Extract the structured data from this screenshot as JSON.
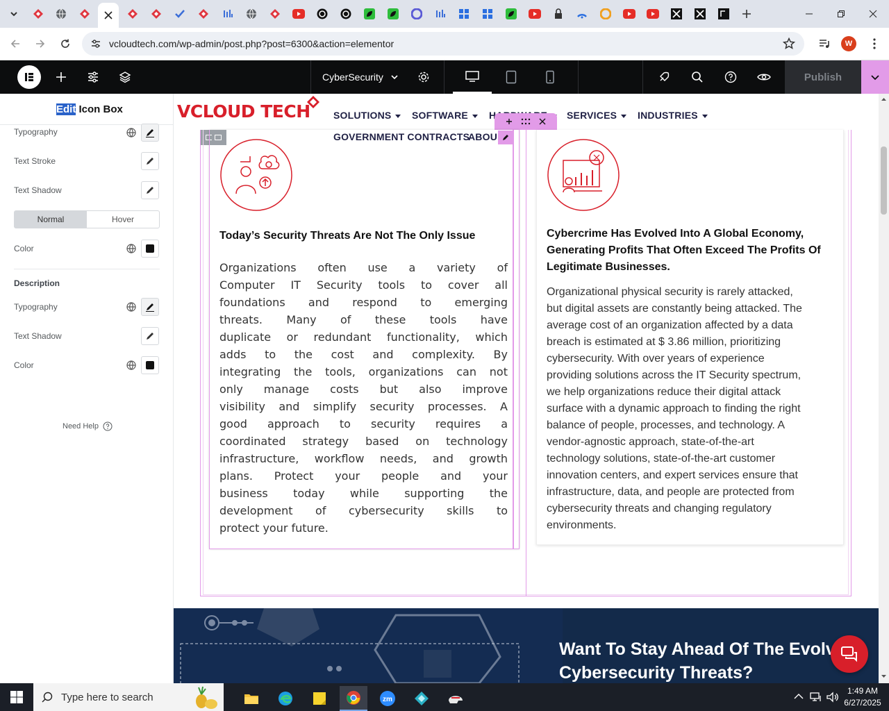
{
  "browser": {
    "url": "vcloudtech.com/wp-admin/post.php?post=6300&action=elementor",
    "tabs": [
      {
        "icon": "gem-icon",
        "color": "#e0363f"
      },
      {
        "icon": "globe-icon",
        "color": "#5f6368"
      },
      {
        "icon": "gem-icon",
        "color": "#e0363f"
      },
      {
        "icon": "close-icon",
        "color": "#222"
      },
      {
        "icon": "gem-icon",
        "color": "#e0363f"
      },
      {
        "icon": "gem-icon",
        "color": "#e0363f"
      },
      {
        "icon": "check-icon",
        "color": "#3b6ed8"
      },
      {
        "icon": "gem-icon",
        "color": "#e0363f"
      },
      {
        "icon": "bars-icon",
        "color": "#3b6ed8"
      },
      {
        "icon": "globe-icon",
        "color": "#5f6368"
      },
      {
        "icon": "gem-icon",
        "color": "#e0363f"
      },
      {
        "icon": "youtube-icon",
        "color": "#e52d27"
      },
      {
        "icon": "openai-icon",
        "color": "#111"
      },
      {
        "icon": "openai-icon",
        "color": "#111"
      },
      {
        "icon": "leaf-icon",
        "color": "#2ebd3c"
      },
      {
        "icon": "leaf-icon",
        "color": "#2ebd3c"
      },
      {
        "icon": "circle-icon",
        "color": "#5b5bd6"
      },
      {
        "icon": "bars-icon",
        "color": "#3b6ed8"
      },
      {
        "icon": "grid-icon",
        "color": "#2b6fe0"
      },
      {
        "icon": "grid-icon",
        "color": "#2b6fe0"
      },
      {
        "icon": "leaf-icon",
        "color": "#2ebd3c"
      },
      {
        "icon": "youtube-icon",
        "color": "#e52d27"
      },
      {
        "icon": "lock-icon",
        "color": "#333"
      },
      {
        "icon": "wifi-icon",
        "color": "#2b6fe0"
      },
      {
        "icon": "circle-icon",
        "color": "#f0a020"
      },
      {
        "icon": "youtube-icon",
        "color": "#e52d27"
      },
      {
        "icon": "youtube-icon",
        "color": "#e52d27"
      },
      {
        "icon": "x-logo-icon",
        "color": "#111"
      },
      {
        "icon": "x-logo-icon",
        "color": "#111"
      },
      {
        "icon": "square-icon",
        "color": "#111"
      }
    ],
    "profile_initial": "W"
  },
  "elementor": {
    "page_name": "CyberSecurity",
    "publish_label": "Publish"
  },
  "panel": {
    "title_highlight": "Edit",
    "title_rest": " Icon Box",
    "typography_label": "Typography",
    "text_stroke_label": "Text Stroke",
    "text_shadow_label": "Text Shadow",
    "normal_tab": "Normal",
    "hover_tab": "Hover",
    "color_label": "Color",
    "description_heading": "Description",
    "desc_typography_label": "Typography",
    "desc_text_shadow_label": "Text Shadow",
    "desc_color_label": "Color",
    "need_help": "Need Help"
  },
  "site": {
    "logo_text": "VCLOUD TECH",
    "menu": [
      "SOLUTIONS",
      "SOFTWARE",
      "HARDWARE",
      "SERVICES",
      "INDUSTRIES"
    ],
    "menu2": [
      "GOVERNMENT CONTRACTS",
      "ABOUT US"
    ],
    "card1": {
      "title": "Today’s Security Threats Are Not The Only Issue",
      "lines": [
        "Organizations often use a variety of",
        "Computer IT Security tools to cover all",
        "foundations and respond to emerging",
        "threats. Many of these tools have",
        "duplicate or redundant functionality, which",
        "adds to the cost and complexity. By",
        "integrating the tools, organizations can not",
        "only manage costs but also improve",
        "visibility and simplify security processes. A",
        "good approach to security requires a",
        "coordinated strategy based on technology",
        "infrastructure, workflow needs, and growth",
        "plans. Protect your people and your",
        "business today while supporting the",
        "development of cybersecurity skills to",
        "protect your future."
      ]
    },
    "card2": {
      "title_lines": [
        "Cybercrime Has Evolved Into A Global Economy,",
        "Generating Profits That Often Exceed The Profits Of",
        "Legitimate Businesses."
      ],
      "lines": [
        "Organizational physical security is rarely attacked,",
        "but digital assets are constantly being attacked. The",
        "average cost of an organization affected by a data",
        "breach is estimated at $ 3.86 million, prioritizing",
        "cybersecurity. With over years of experience",
        "providing solutions across the IT Security spectrum,",
        "we help organizations reduce their digital attack",
        "surface with a dynamic approach to finding the right",
        "balance of people, processes, and technology. A",
        "vendor-agnostic approach, state-of-the-art",
        "technology solutions, state-of-the-art customer",
        "innovation centers, and expert services ensure that",
        "infrastructure, data, and people are protected from",
        "cybersecurity threats and changing regulatory",
        "environments."
      ]
    },
    "banner_line1": "Want To Stay Ahead Of The Evolvir",
    "banner_line2": "Cybersecurity Threats?"
  },
  "taskbar": {
    "search_placeholder": "Type here to search",
    "time": "1:49 AM",
    "date": "6/27/2025"
  },
  "colors": {
    "brand_red": "#d81f2a",
    "brand_navy": "#1f2044",
    "elementor_pink": "#e29be8",
    "banner_bg": "#132a4a"
  }
}
